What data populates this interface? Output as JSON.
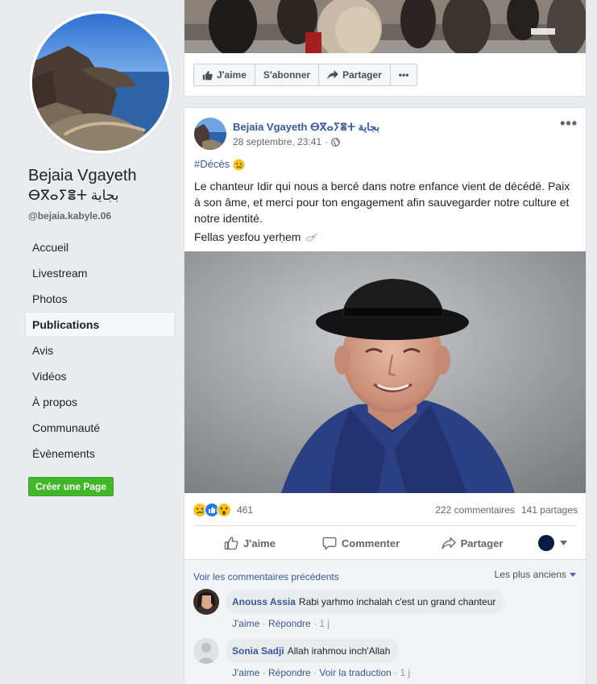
{
  "sidebar": {
    "page_name": "Bejaia Vgayeth",
    "page_name_alt": "ⴱⴳⴰⵢⴻⵜ بجاية",
    "handle": "@bejaia.kabyle.06",
    "nav": [
      "Accueil",
      "Livestream",
      "Photos",
      "Publications",
      "Avis",
      "Vidéos",
      "À propos",
      "Communauté",
      "Évènements"
    ],
    "active_nav": "Publications",
    "create_page": "Créer une Page"
  },
  "top_card": {
    "like": "J'aime",
    "subscribe": "S'abonner",
    "share": "Partager",
    "more": "•••"
  },
  "post": {
    "author": "Bejaia Vgayeth ⴱⴳⴰⵢⴻⵜ بجاية",
    "date": "28 septembre, 23:41",
    "more": "•••",
    "hashtag": "#Décès",
    "text": "Le chanteur Idir qui nous a bercé dans notre enfance vient de décédé. Paix à son âme, et merci pour ton engagement afin sauvegarder notre culture et notre identité.",
    "text2": "Fellas yeɛfou yerḥem",
    "reaction_count": "461",
    "comments_count": "222 commentaires",
    "shares_count": "141 partages",
    "actions": {
      "like": "J'aime",
      "comment": "Commenter",
      "share": "Partager"
    }
  },
  "comments": {
    "previous": "Voir les commentaires précédents",
    "sort": "Les plus anciens",
    "items": [
      {
        "author": "Anouss Assia",
        "text": "Rabi yarhmo inchalah c'est un grand chanteur",
        "like": "J'aime",
        "reply": "Répondre",
        "time": "1 j"
      },
      {
        "author": "Sonia Sadji",
        "text": "Allah irahmou inch'Allah",
        "like": "J'aime",
        "reply": "Répondre",
        "translate": "Voir la traduction",
        "time": "1 j"
      }
    ]
  },
  "colors": {
    "link": "#385898",
    "green": "#42b72a",
    "bg": "#e9ebee"
  }
}
